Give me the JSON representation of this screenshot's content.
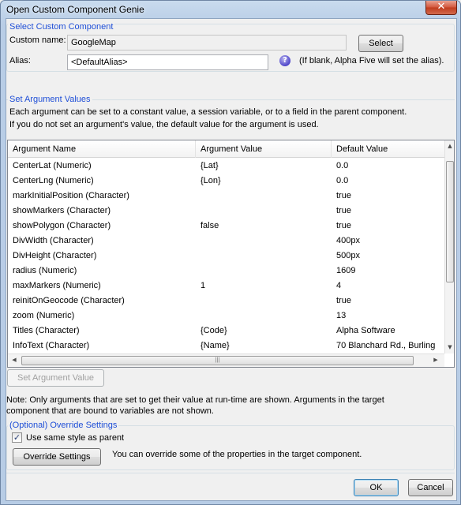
{
  "window": {
    "title": "Open Custom Component Genie",
    "close_glyph": "✕"
  },
  "select_group": {
    "title": "Select Custom Component",
    "custom_name_label": "Custom name:",
    "custom_name_value": "GoogleMap",
    "select_button": "Select",
    "alias_label": "Alias:",
    "alias_value": "<DefaultAlias>",
    "help_glyph": "?",
    "alias_hint": "(If blank, Alpha Five will set the alias)."
  },
  "args_group": {
    "title": "Set Argument Values",
    "desc_line1": "Each argument can be set to a constant value, a session variable, or to a field in the parent component.",
    "desc_line2": "If you do not set an argument's value, the default value for the argument is used."
  },
  "grid": {
    "columns": [
      "Argument Name",
      "Argument Value",
      "Default Value"
    ],
    "rows": [
      [
        "CenterLat (Numeric)",
        "{Lat}",
        "0.0"
      ],
      [
        "CenterLng (Numeric)",
        "{Lon}",
        "0.0"
      ],
      [
        "markInitialPosition (Character)",
        "",
        "true"
      ],
      [
        "showMarkers (Character)",
        "",
        "true"
      ],
      [
        "showPolygon (Character)",
        "false",
        "true"
      ],
      [
        "DivWidth (Character)",
        "",
        "400px"
      ],
      [
        "DivHeight (Character)",
        "",
        "500px"
      ],
      [
        "radius (Numeric)",
        "",
        "1609"
      ],
      [
        "maxMarkers (Numeric)",
        "1",
        "4"
      ],
      [
        "reinitOnGeocode (Character)",
        "",
        "true"
      ],
      [
        "zoom (Numeric)",
        "",
        "13"
      ],
      [
        "Titles (Character)",
        "{Code}",
        "Alpha Software"
      ],
      [
        "InfoText (Character)",
        "{Name}",
        "70 Blanchard Rd., Burling"
      ]
    ],
    "scroll_up": "▲",
    "scroll_down": "▼",
    "scroll_left": "◀",
    "scroll_right": "▶",
    "thumb_grip": "|||"
  },
  "set_value_button": "Set Argument Value",
  "note_line1": "Note: Only arguments that are set to get their value at run-time are shown. Arguments in the target",
  "note_line2": "component that are bound to variables are not shown.",
  "override_group": {
    "title": "(Optional) Override Settings",
    "checkbox_label": "Use same style as parent",
    "checkbox_checked": "✓",
    "override_button": "Override Settings",
    "override_hint": "You can override some of the properties in the target component."
  },
  "ok_button": "OK",
  "cancel_button": "Cancel"
}
